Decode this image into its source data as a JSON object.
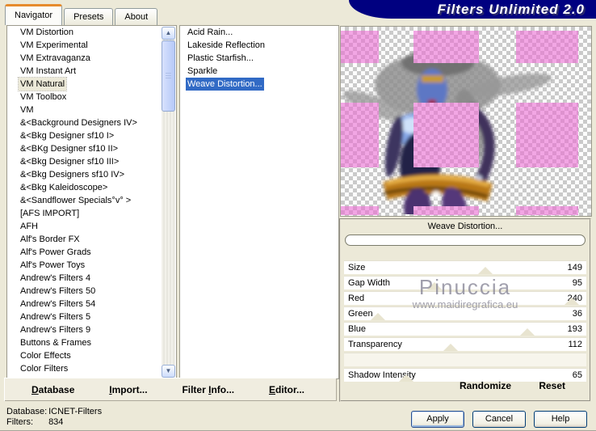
{
  "window": {
    "title": "Filters Unlimited 2.0"
  },
  "tabs": [
    {
      "label": "Navigator",
      "active": true
    },
    {
      "label": "Presets",
      "active": false
    },
    {
      "label": "About",
      "active": false
    }
  ],
  "category_list": {
    "selected": "VM Natural",
    "items": [
      "VM Distortion",
      "VM Experimental",
      "VM Extravaganza",
      "VM Instant Art",
      "VM Natural",
      "VM Toolbox",
      "VM",
      "&<Background Designers IV>",
      "&<Bkg Designer sf10 I>",
      "&<BKg Designer sf10 II>",
      "&<Bkg Designer sf10 III>",
      "&<Bkg Designers sf10 IV>",
      "&<Bkg Kaleidoscope>",
      "&<Sandflower Specials°v° >",
      "[AFS IMPORT]",
      "AFH",
      "Alf's Border FX",
      "Alf's Power Grads",
      "Alf's Power Toys",
      "Andrew's Filters 4",
      "Andrew's Filters 50",
      "Andrew's Filters 54",
      "Andrew's Filters 5",
      "Andrew's Filters 9",
      "Buttons & Frames",
      "Color Effects",
      "Color Filters"
    ]
  },
  "filter_list": {
    "selected": "Weave Distortion...",
    "items": [
      "Acid Rain...",
      "Lakeside Reflection",
      "Plastic Starfish...",
      "Sparkle",
      "Weave Distortion..."
    ]
  },
  "preview": {
    "caption": "Weave Distortion...",
    "progress": 0
  },
  "sliders": [
    {
      "label": "Size",
      "value": 149,
      "max": 255
    },
    {
      "label": "Gap Width",
      "value": 95,
      "max": 255
    },
    {
      "label": "Red",
      "value": 240,
      "max": 255
    },
    {
      "label": "Green",
      "value": 36,
      "max": 255
    },
    {
      "label": "Blue",
      "value": 193,
      "max": 255
    },
    {
      "label": "Transparency",
      "value": 112,
      "max": 255
    },
    {
      "label": "Shadow Intensity",
      "value": 65,
      "max": 255
    }
  ],
  "watermark": {
    "line1": "Pinuccia",
    "line2": "www.maidiregrafica.eu"
  },
  "toolbar": {
    "database_label": "Database",
    "import_label": "Import...",
    "filter_info_label": "Filter Info...",
    "editor_label": "Editor...",
    "randomize_label": "Randomize",
    "reset_label": "Reset"
  },
  "status": {
    "database_label": "Database:",
    "database_value": "ICNET-Filters",
    "filters_label": "Filters:",
    "filters_value": "834"
  },
  "dialog_buttons": {
    "apply": "Apply",
    "cancel": "Cancel",
    "help": "Help"
  },
  "icons": {
    "scroll_up": "▲",
    "scroll_down": "▼"
  },
  "colors": {
    "selection_blue": "#316ac5",
    "banner_navy": "#000080",
    "weave_pink": "#f2a6e4",
    "dialog_bg": "#ece9d8",
    "active_tab_accent": "#e68b2c"
  }
}
